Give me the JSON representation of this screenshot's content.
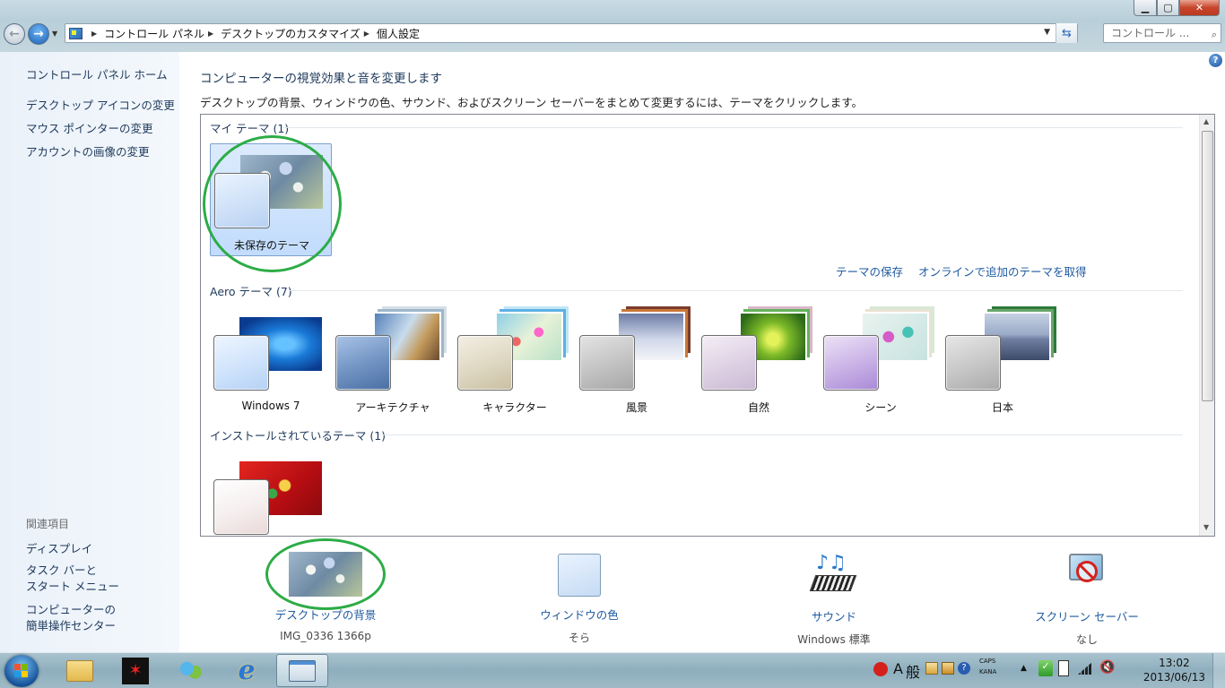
{
  "window": {
    "controls": {
      "minimize": "▁",
      "maximize": "▢",
      "close": "✕"
    }
  },
  "addressbar": {
    "crumbs": [
      "コントロール パネル",
      "デスクトップのカスタマイズ",
      "個人設定"
    ],
    "search_placeholder": "コントロール ..."
  },
  "sidebar": {
    "home": "コントロール パネル ホーム",
    "links": [
      "デスクトップ アイコンの変更",
      "マウス ポインターの変更",
      "アカウントの画像の変更"
    ],
    "related_heading": "関連項目",
    "related": [
      "ディスプレイ",
      "タスク バーと\nスタート メニュー",
      "コンピューターの\n簡単操作センター"
    ]
  },
  "main": {
    "title": "コンピューターの視覚効果と音を変更します",
    "description": "デスクトップの背景、ウィンドウの色、サウンド、およびスクリーン セーバーをまとめて変更するには、テーマをクリックします。",
    "my_themes": {
      "heading": "マイ テーマ (1)",
      "items": [
        {
          "label": "未保存のテーマ",
          "selected": true
        }
      ]
    },
    "save_theme_link": "テーマの保存",
    "online_themes_link": "オンラインで追加のテーマを取得",
    "aero_themes": {
      "heading": "Aero テーマ (7)",
      "items": [
        {
          "label": "Windows 7"
        },
        {
          "label": "アーキテクチャ"
        },
        {
          "label": "キャラクター"
        },
        {
          "label": "風景"
        },
        {
          "label": "自然"
        },
        {
          "label": "シーン"
        },
        {
          "label": "日本"
        }
      ]
    },
    "installed_themes": {
      "heading": "インストールされているテーマ (1)"
    }
  },
  "settings": [
    {
      "label": "デスクトップの背景",
      "value": "IMG_0336  1366p",
      "icon": "wallpaper-thumbnail"
    },
    {
      "label": "ウィンドウの色",
      "value": "そら",
      "icon": "window-color-swatch-icon"
    },
    {
      "label": "サウンド",
      "value": "Windows 標準",
      "icon": "music-notes-icon"
    },
    {
      "label": "スクリーン セーバー",
      "value": "なし",
      "icon": "no-screensaver-icon"
    }
  ],
  "taskbar": {
    "ime_mode": "A",
    "ime_kanji": "般",
    "caps": "CAPS",
    "kana": "KANA",
    "time": "13:02",
    "date": "2013/06/13"
  },
  "colors": {
    "link": "#1e5aa0",
    "heading": "#1e395b",
    "annotation": "#2dac46",
    "selection": "#c2dcfd"
  }
}
